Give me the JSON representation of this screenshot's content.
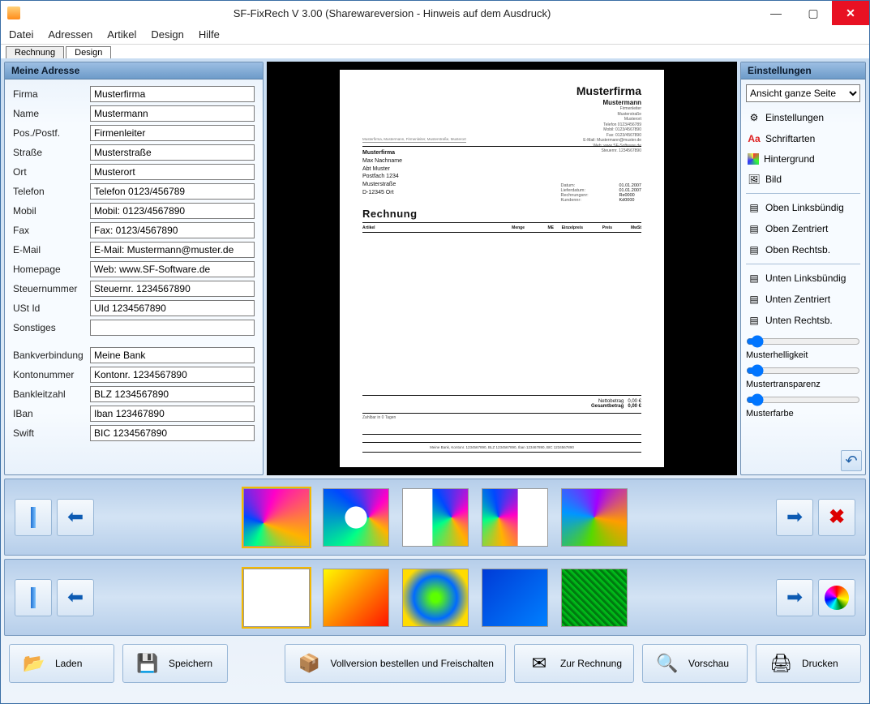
{
  "titlebar": {
    "title": "SF-FixRech  V 3.00 (Sharewareversion - Hinweis auf dem Ausdruck)"
  },
  "menu": [
    "Datei",
    "Adressen",
    "Artikel",
    "Design",
    "Hilfe"
  ],
  "tabs": {
    "rechnung": "Rechnung",
    "design": "Design"
  },
  "leftpanel": {
    "title": "Meine Adresse",
    "fields": {
      "firma": {
        "label": "Firma",
        "value": "Musterfirma"
      },
      "name": {
        "label": "Name",
        "value": "Mustermann"
      },
      "pos": {
        "label": "Pos./Postf.",
        "value": "Firmenleiter"
      },
      "strasse": {
        "label": "Straße",
        "value": "Musterstraße"
      },
      "ort": {
        "label": "Ort",
        "value": "Musterort"
      },
      "telefon": {
        "label": "Telefon",
        "value": "Telefon 0123/456789"
      },
      "mobil": {
        "label": "Mobil",
        "value": "Mobil: 0123/4567890"
      },
      "fax": {
        "label": "Fax",
        "value": "Fax: 0123/4567890"
      },
      "email": {
        "label": "E-Mail",
        "value": "E-Mail: Mustermann@muster.de"
      },
      "homepage": {
        "label": "Homepage",
        "value": "Web: www.SF-Software.de"
      },
      "steuernr": {
        "label": "Steuernummer",
        "value": "Steuernr. 1234567890"
      },
      "ustid": {
        "label": "USt Id",
        "value": "UId 1234567890"
      },
      "sonstiges": {
        "label": "Sonstiges",
        "value": ""
      },
      "bank": {
        "label": "Bankverbindung",
        "value": "Meine Bank"
      },
      "konto": {
        "label": "Kontonummer",
        "value": "Kontonr. 1234567890"
      },
      "blz": {
        "label": "Bankleitzahl",
        "value": "BLZ 1234567890"
      },
      "iban": {
        "label": "IBan",
        "value": "Iban 123467890"
      },
      "swift": {
        "label": "Swift",
        "value": "BIC 1234567890"
      }
    }
  },
  "preview": {
    "company": "Musterfirma",
    "person": "Mustermann",
    "headerLines": [
      "Firmenleiter",
      "Musterstraße",
      "Musterort",
      "Telefon 0123/456789",
      "Mobil: 0123/4567890",
      "Fax: 0123/4567890",
      "E-Mail: Mustermann@muster.de",
      "Web: www.SF-Software.de",
      "Steuernr. 1234567890"
    ],
    "senderLine": "Musterfirma, Mustermann, Firmenleiter, Musterstraße, Musterort",
    "addr": {
      "s1": "Musterfirma",
      "s2": "Max Nachname",
      "s3": "Abt Muster",
      "s4": "Postfach 1234",
      "s5": "Musterstraße",
      "s6": "D-12345 Ort"
    },
    "info": {
      "datum_l": "Datum:",
      "datum_v": "01.01.2007",
      "liefer_l": "Lieferdatum:",
      "liefer_v": "01.01.2007",
      "rnr_l": "Rechnungsnr:",
      "rnr_v": "Re0000",
      "knr_l": "Kundennr:",
      "knr_v": "Kd0000"
    },
    "invoiceTitle": "Rechnung",
    "cols": [
      "Artikel",
      "Menge",
      "ME",
      "Einzelpreis",
      "Preis",
      "MwSt"
    ],
    "totals": {
      "netto_l": "Nettobetrag",
      "netto_v": "0,00 €",
      "gesamt_l": "Gesamtbetrag",
      "gesamt_v": "0,00 €"
    },
    "payline": "Zahlbar in 0 Tagen",
    "bankline": "Meine Bank, Kontonr. 1234567890, BLZ 1234567890, Iban 123467890, BIC 1234567890"
  },
  "rightpanel": {
    "title": "Einstellungen",
    "view": "Ansicht ganze Seite",
    "items": {
      "einst": "Einstellungen",
      "fonts": "Schriftarten",
      "hinter": "Hintergrund",
      "bild": "Bild",
      "otl": "Oben Linksbündig",
      "otc": "Oben Zentriert",
      "otr": "Oben Rechtsb.",
      "utl": "Unten Linksbündig",
      "utc": "Unten Zentriert",
      "utr": "Unten Rechtsb."
    },
    "sliders": {
      "hell": "Musterhelligkeit",
      "trans": "Mustertransparenz",
      "farbe": "Musterfarbe"
    }
  },
  "bottom": {
    "laden": "Laden",
    "speichern": "Speichern",
    "voll": "Vollversion bestellen und Freischalten",
    "zur": "Zur Rechnung",
    "vorschau": "Vorschau",
    "drucken": "Drucken"
  }
}
